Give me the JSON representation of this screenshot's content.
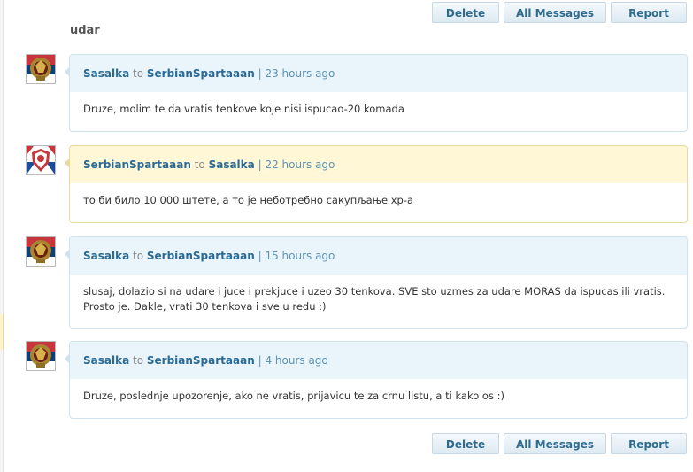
{
  "buttons": {
    "delete": "Delete",
    "all_messages": "All Messages",
    "report": "Report"
  },
  "thread": {
    "title": "udar"
  },
  "to_word": "to",
  "messages": [
    {
      "from": "Sasalka",
      "to": "SerbianSpartaaan",
      "time": "23 hours ago",
      "text": "Druze, molim te da vratis tenkove koje nisi ispucao-20 komada"
    },
    {
      "from": "SerbianSpartaaan",
      "to": "Sasalka",
      "time": "22 hours ago",
      "text": "то би било 10 000 штете, а то је неботребно сакупљање хр-а"
    },
    {
      "from": "Sasalka",
      "to": "SerbianSpartaaan",
      "time": "15 hours ago",
      "text": "slusaj, dolazio si na udare i juce i prekjuce i uzeo 30 tenkova. SVE sto uzmes za udare MORAS da ispucas ili vratis. Prosto je. Dakle, vrati 30 tenkova i sve u redu :)"
    },
    {
      "from": "Sasalka",
      "to": "SerbianSpartaaan",
      "time": "4 hours ago",
      "text": "Druze, poslednje upozorenje, ako ne vratis, prijavicu te za crnu listu, a ti kako os :)"
    }
  ]
}
